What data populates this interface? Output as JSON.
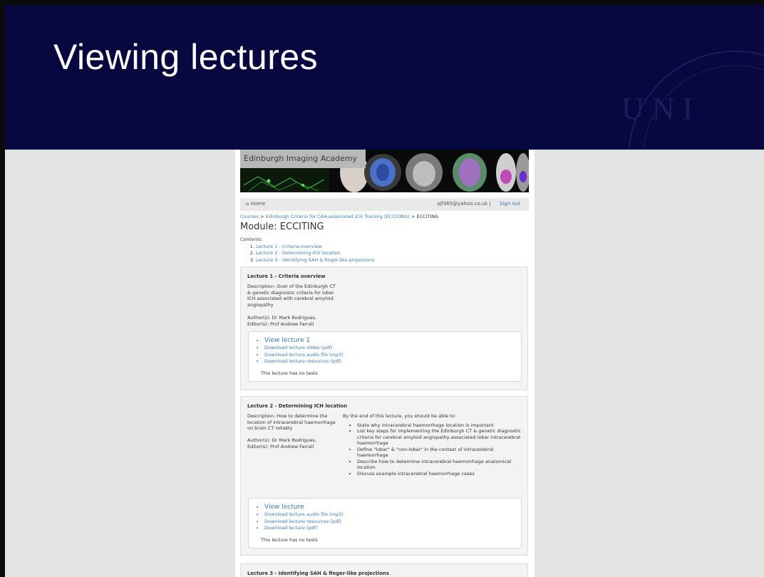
{
  "slide": {
    "title": "Viewing lectures"
  },
  "site": {
    "banner_label": "Edinburgh Imaging Academy",
    "nav": {
      "home": "Home",
      "email": "ajf365@yahoo.co.uk |",
      "sign_out": "Sign out"
    },
    "breadcrumb": {
      "courses": "Courses",
      "sep1": " > ",
      "course": "Edinburgh Criteria for CAA-associated ICH Training (ECCITING)",
      "sep2": " > ",
      "current": "ECCITING"
    },
    "module_title": "Module: ECCITING",
    "contents_label": "Contents:",
    "contents": [
      "Lecture 1 - Criteria overview",
      "Lecture 2 - Determining ICH location",
      "Lecture 3 - Identifying SAH & finger-like projections"
    ]
  },
  "lectures": [
    {
      "title": "Lecture 1 - Criteria overview",
      "description": "Description: Over of the Edinburgh CT & genetic diagnostic criteria for lobar ICH associated with cerebral amyloid angiopathy",
      "authors": "Author(s): Dr Mark Rodrigues,",
      "editors": "Editor(s): Prof Andrew Farrall",
      "view_link": "View lecture 1",
      "links": [
        "Download lecture slides (pdf)",
        "Download lecture audio file (mp3)",
        "Download lecture resources (pdf)"
      ],
      "tests": "This lecture has no tests"
    },
    {
      "title": "Lecture 2 - Determining ICH location",
      "description": "Description: How to determine the location of intracerebral haemorrhage on brain CT reliably",
      "authors": "Author(s): Dr Mark Rodrigues,",
      "editors": "Editor(s): Prof Andrew Farrall",
      "objectives_intro": "By the end of this lecture, you should be able to:",
      "objectives": [
        "State why intracerebral haemorrhage location is important",
        "List key steps for implementing the Edinburgh CT & genetic diagnostic criteria for cerebral amyloid angiopathy-associated lobar intracerebral haemorrhage",
        "Define \"lobar\" & \"non-lobar\" in the context of intracerebral haemorrhage",
        "Describe how to determine intracerebral haemorrhage anatomical location",
        "Discuss example intracerebral haemorrhage cases"
      ],
      "view_link": "View lecture",
      "links": [
        "Download lecture audio file (mp3)",
        "Download lecture resources (pdf)",
        "Download lecture (pdf)"
      ],
      "tests": "This lecture has no tests"
    },
    {
      "title": "Lecture 3 - Identifying SAH & finger-like projections"
    }
  ],
  "watermark_text": "U N I",
  "colors": {
    "header": "#06083f",
    "link": "#3d7cb8",
    "slide_bg": "#e4e4e4"
  }
}
